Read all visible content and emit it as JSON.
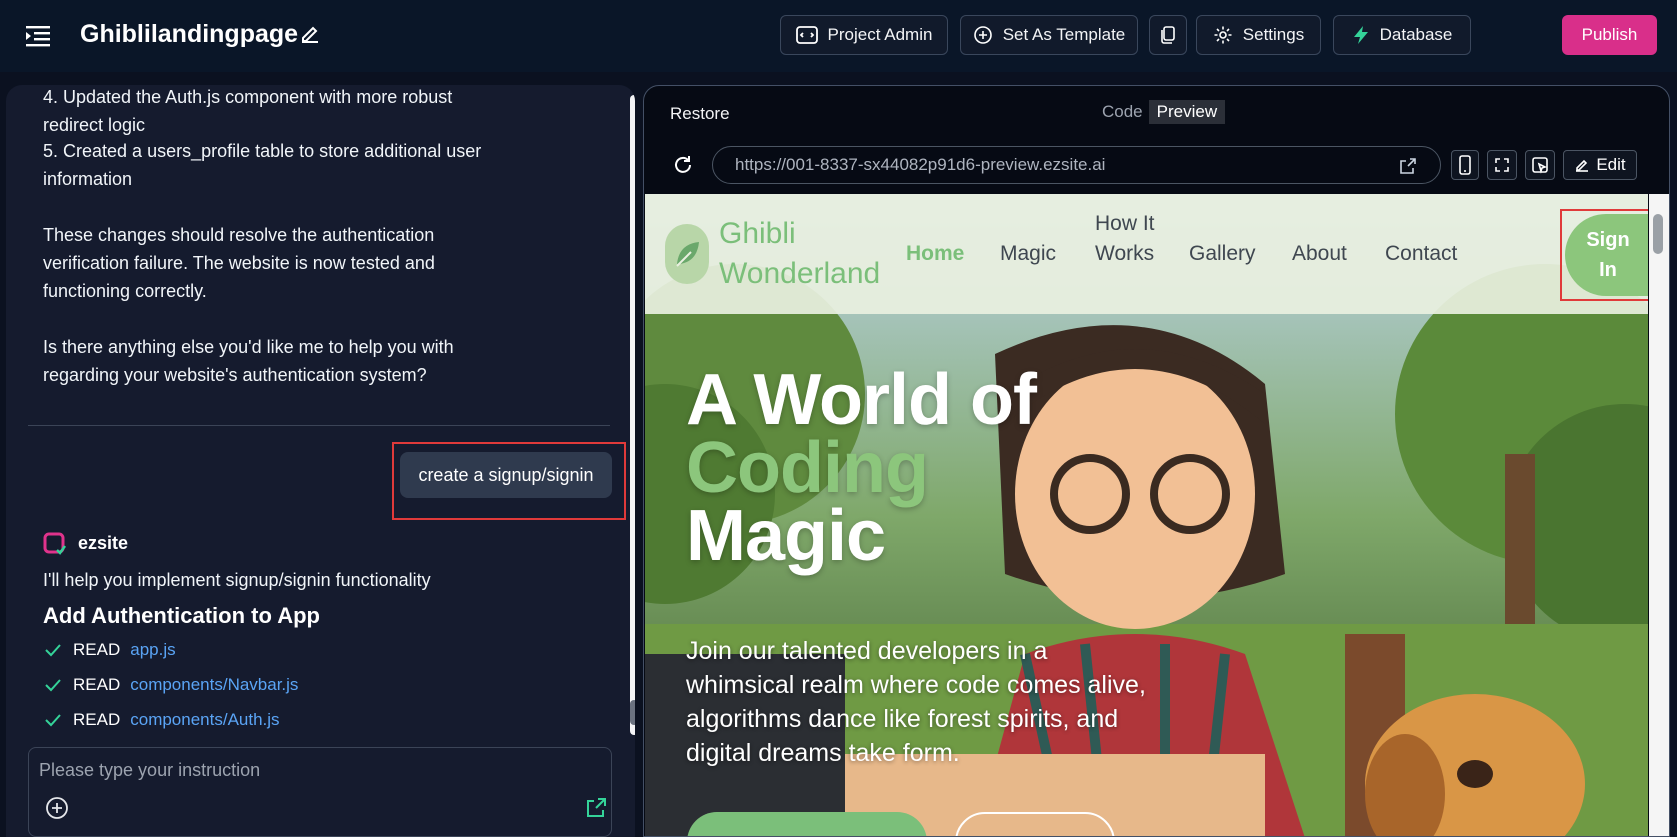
{
  "topbar": {
    "title": "Ghiblilandingpage",
    "buttons": {
      "project_admin": "Project Admin",
      "set_template": "Set As Template",
      "settings": "Settings",
      "database": "Database",
      "publish": "Publish"
    }
  },
  "chat": {
    "messages": {
      "line4": "4. Updated the Auth.js component with more robust redirect logic",
      "line5": "5. Created a users_profile table to store additional user information",
      "summary": "These changes should resolve the authentication verification failure. The website is now tested and functioning correctly.",
      "question": "Is there anything else you'd like me to help you with regarding your website's authentication system?"
    },
    "user_message": "create a signup/signin",
    "bot_name": "ezsite",
    "bot_intro": "I'll help you implement signup/signin functionality",
    "bot_heading": "Add Authentication to App",
    "steps": [
      {
        "verb": "READ",
        "file": "app.js"
      },
      {
        "verb": "READ",
        "file": "components/Navbar.js"
      },
      {
        "verb": "READ",
        "file": "components/Auth.js"
      }
    ],
    "input_placeholder": "Please type your instruction"
  },
  "preview": {
    "restore": "Restore",
    "tab_code": "Code",
    "tab_preview": "Preview",
    "url": "https://001-8337-sx44082p91d6-preview.ezsite.ai",
    "edit_label": "Edit"
  },
  "site": {
    "brand": "Ghibli Wonderland",
    "nav": [
      "Home",
      "Magic",
      "How It Works",
      "Gallery",
      "About",
      "Contact"
    ],
    "signin": "Sign In",
    "hero_line1": "A World of",
    "hero_line2": "Coding",
    "hero_line3": "Magic",
    "hero_text": "Join our talented developers in a whimsical realm where code comes alive, algorithms dance like forest spirits, and digital dreams take form."
  },
  "colors": {
    "publish": "#d92f8a",
    "database_icon": "#34d399",
    "accent_green": "#7bbf7a",
    "highlight_frame": "#e03a3a"
  }
}
